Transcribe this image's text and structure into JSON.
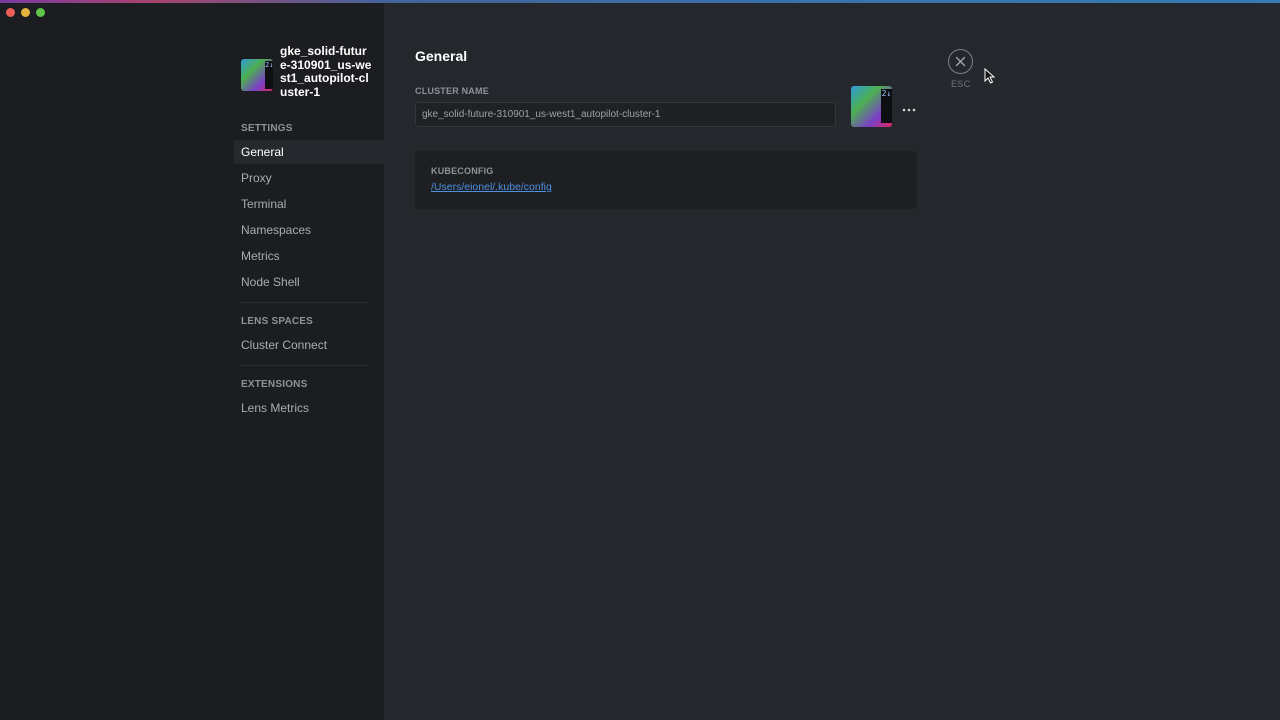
{
  "window": {
    "traffic_lights": [
      {
        "name": "close",
        "color": "#ec5f57"
      },
      {
        "name": "minimize",
        "color": "#e4b33c"
      },
      {
        "name": "maximize",
        "color": "#5fc447"
      }
    ]
  },
  "cluster": {
    "name": "gke_solid-future-310901_us-west1_autopilot-cluster-1",
    "badge_text": "2↓"
  },
  "sidebar": {
    "settings_title": "SETTINGS",
    "settings_items": [
      {
        "label": "General",
        "active": true
      },
      {
        "label": "Proxy"
      },
      {
        "label": "Terminal"
      },
      {
        "label": "Namespaces"
      },
      {
        "label": "Metrics"
      },
      {
        "label": "Node Shell"
      }
    ],
    "lens_spaces_title": "LENS SPACES",
    "lens_spaces_items": [
      {
        "label": "Cluster Connect"
      }
    ],
    "extensions_title": "EXTENSIONS",
    "extensions_items": [
      {
        "label": "Lens Metrics"
      }
    ]
  },
  "main": {
    "title": "General",
    "cluster_name_label": "CLUSTER NAME",
    "cluster_name_value": "gke_solid-future-310901_us-west1_autopilot-cluster-1",
    "more_icon": "ellipsis-icon",
    "kubeconfig_label": "KUBECONFIG",
    "kubeconfig_path": "/Users/eionel/.kube/config"
  },
  "close": {
    "icon": "close-icon",
    "label": "ESC"
  },
  "colors": {
    "sidebar_bg": "#1b1d20",
    "content_bg": "#24272b",
    "link": "#4e8fe0",
    "active_item_bg": "#25282c"
  }
}
